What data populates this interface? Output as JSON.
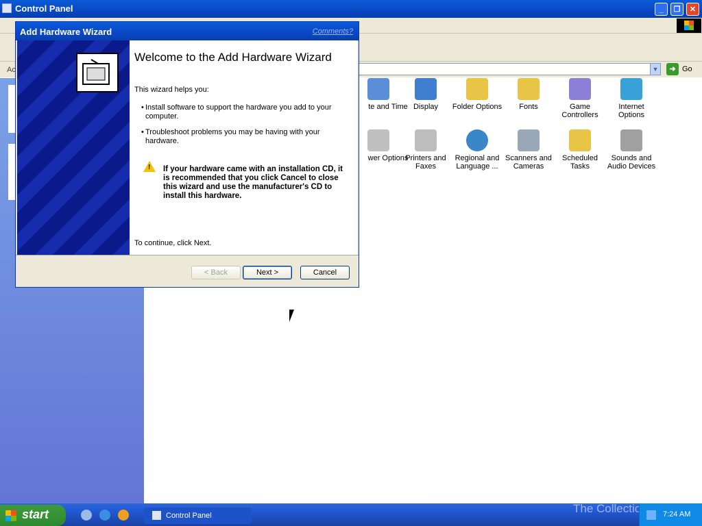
{
  "control_panel": {
    "title": "Control Panel",
    "address_label": "Ac",
    "go_label": "Go",
    "items": [
      {
        "label": "te and Time",
        "icon": "date-time-icon",
        "color": "#5a8fd8"
      },
      {
        "label": "Display",
        "icon": "display-icon",
        "color": "#3f7fd0"
      },
      {
        "label": "Folder Options",
        "icon": "folder-options-icon",
        "color": "#e8c547"
      },
      {
        "label": "Fonts",
        "icon": "fonts-icon",
        "color": "#e8c547"
      },
      {
        "label": "Game Controllers",
        "icon": "game-controller-icon",
        "color": "#8b7fd8"
      },
      {
        "label": "Internet Options",
        "icon": "internet-options-icon",
        "color": "#3aa0d8"
      },
      {
        "label": "wer Options",
        "icon": "power-options-icon",
        "color": "#c0c0c0"
      },
      {
        "label": "Printers and Faxes",
        "icon": "printer-icon",
        "color": "#bdbdbd"
      },
      {
        "label": "Regional and Language ...",
        "icon": "globe-icon",
        "color": "#3a86c8"
      },
      {
        "label": "Scanners and Cameras",
        "icon": "scanner-icon",
        "color": "#9aa8b8"
      },
      {
        "label": "Scheduled Tasks",
        "icon": "scheduled-tasks-icon",
        "color": "#e8c547"
      },
      {
        "label": "Sounds and Audio Devices",
        "icon": "speaker-icon",
        "color": "#a0a0a0"
      }
    ]
  },
  "wizard": {
    "title": "Add Hardware Wizard",
    "comments_link": "Comments?",
    "heading": "Welcome to the Add Hardware Wizard",
    "intro": "This wizard helps you:",
    "bullets": [
      "Install software to support the hardware you add to your computer.",
      "Troubleshoot problems you may be having with your hardware."
    ],
    "warning": "If your hardware came with an installation CD, it is recommended that you click Cancel to close this wizard and use the manufacturer's CD to install this hardware.",
    "continue_text": "To continue, click Next.",
    "buttons": {
      "back": "< Back",
      "next": "Next >",
      "cancel": "Cancel"
    }
  },
  "taskbar": {
    "start_label": "start",
    "task_label": "Control Panel",
    "clock": "7:24 AM",
    "watermark": "The Collection Book"
  }
}
